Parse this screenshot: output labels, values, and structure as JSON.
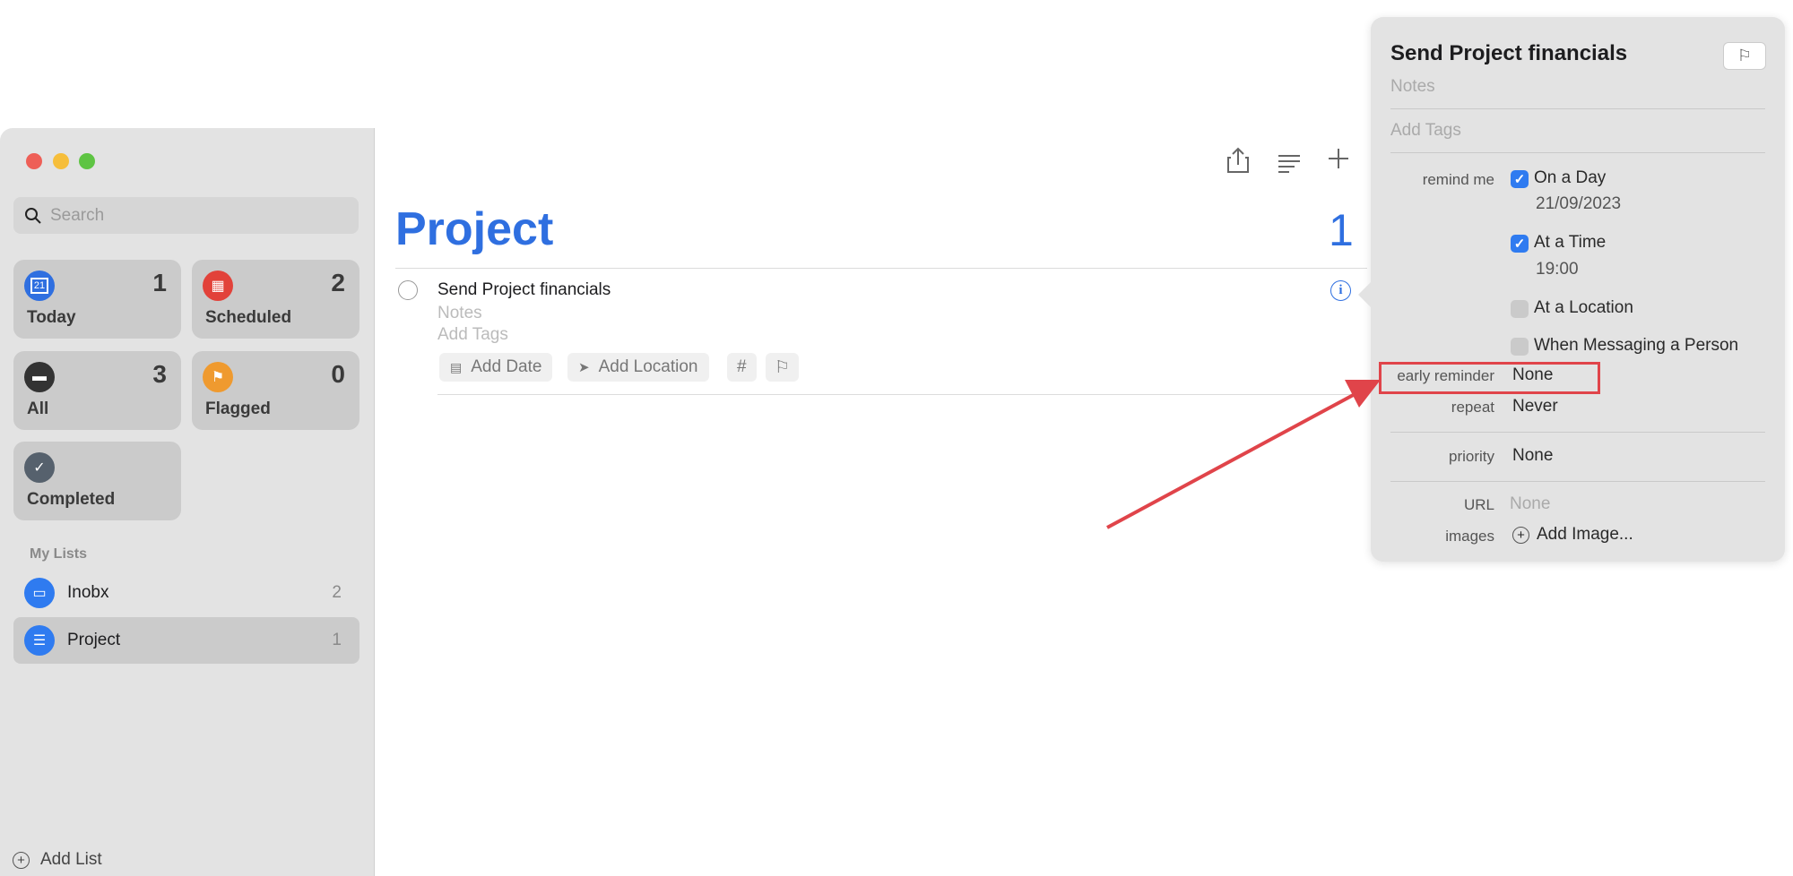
{
  "sidebar": {
    "search_placeholder": "Search",
    "smart_lists": [
      {
        "label": "Today",
        "count": "1",
        "icon": "calendar-today-icon",
        "color": "#2f6fe0",
        "glyph": "21"
      },
      {
        "label": "Scheduled",
        "count": "2",
        "icon": "calendar-scheduled-icon",
        "color": "#e2423a"
      },
      {
        "label": "All",
        "count": "3",
        "icon": "tray-icon",
        "color": "#333333"
      },
      {
        "label": "Flagged",
        "count": "0",
        "icon": "flag-icon",
        "color": "#ef9a2f"
      },
      {
        "label": "Completed",
        "count": "",
        "icon": "checkmark-icon",
        "color": "#56616d"
      }
    ],
    "my_lists_header": "My Lists",
    "lists": [
      {
        "name": "Inobx",
        "count": "2",
        "icon": "inbox-icon"
      },
      {
        "name": "Project",
        "count": "1",
        "icon": "list-icon",
        "selected": true
      }
    ],
    "add_list": "Add List"
  },
  "main": {
    "title": "Project",
    "count": "1",
    "accent": "#2f6fe0",
    "task": {
      "title": "Send Project financials",
      "notes_placeholder": "Notes",
      "tags_placeholder": "Add Tags",
      "chips": {
        "date": "Add Date",
        "location": "Add Location",
        "tag": "#"
      }
    }
  },
  "popover": {
    "title": "Send Project financials",
    "notes_placeholder": "Notes",
    "tags_placeholder": "Add Tags",
    "remind_me_label": "remind me",
    "on_a_day": {
      "label": "On a Day",
      "checked": true,
      "value": "21/09/2023"
    },
    "at_a_time": {
      "label": "At a Time",
      "checked": true,
      "value": "19:00"
    },
    "at_a_location": {
      "label": "At a Location",
      "checked": false
    },
    "when_messaging": {
      "label": "When Messaging a Person",
      "checked": false
    },
    "early_reminder": {
      "label": "early reminder",
      "value": "None"
    },
    "repeat": {
      "label": "repeat",
      "value": "Never"
    },
    "priority": {
      "label": "priority",
      "value": "None"
    },
    "url": {
      "label": "URL",
      "value": "None"
    },
    "images": {
      "label": "images",
      "value": "Add Image..."
    }
  },
  "annotation": {
    "color": "#e0444a"
  }
}
